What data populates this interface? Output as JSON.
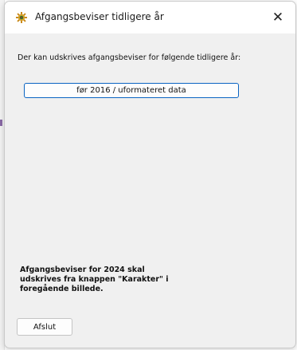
{
  "window": {
    "title": "Afgangsbeviser tidligere år",
    "close_glyph": "✕",
    "icon": "app-logo-icon"
  },
  "main": {
    "info_text": "Der kan udskrives afgangsbeviser for følgende tidligere år:",
    "options": [
      {
        "label": "før 2016 / uformateret  data"
      }
    ],
    "note": "Afgangsbeviser for 2024 skal\nudskrives fra knappen \"Karakter\" i\nforegående billede."
  },
  "footer": {
    "close_label": "Afslut"
  },
  "colors": {
    "accent": "#0a64c2",
    "dialog_background": "#f0f0f0",
    "titlebar_background": "#ffffff"
  }
}
